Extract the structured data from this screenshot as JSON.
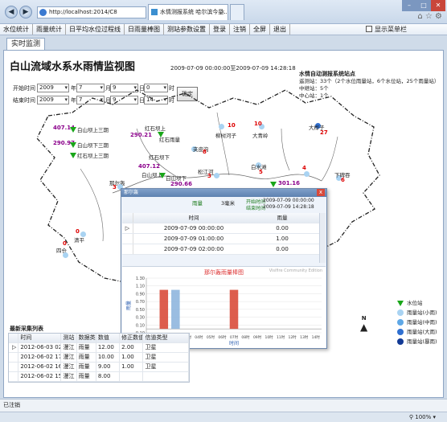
{
  "browser": {
    "address": "http://localhost:2014/C8",
    "tabs": [
      {
        "label": "水情测报系统 哈尔滨今星..."
      },
      {
        "label": ""
      }
    ],
    "window_buttons": [
      "–",
      "□",
      "✕"
    ]
  },
  "menu": {
    "items": [
      "水位统计",
      "雨量统计",
      "日平均水位过程线",
      "日雨量棒图",
      "测站参数设置",
      "登录",
      "注销",
      "全屏",
      "退出"
    ],
    "show_menu_label": "显示菜单栏"
  },
  "page_tab": "实时监测",
  "page": {
    "title": "白山流域水系水雨情监视图",
    "time_range": "2009-07-09 00:00:00至2009-07-09 14:28:18",
    "start_label": "开始时间",
    "end_label": "结束时间",
    "start": {
      "year": "2009",
      "month": "7",
      "day": "9",
      "hour": "0"
    },
    "end": {
      "year": "2009",
      "month": "7",
      "day": "9",
      "hour": "14"
    },
    "unit_year": "年",
    "unit_month": "月",
    "unit_day": "日",
    "unit_hour": "时",
    "query_button": "确定"
  },
  "station_info": {
    "heading": "水情自动测报系统站点",
    "line1": "遥测站：33个（2个水位雨量站，6个水位站，25个雨量站）",
    "line2": "中继站：5个",
    "line3": "中心站：1个"
  },
  "map": {
    "stations": [
      {
        "name": "白山坝上三期",
        "value": "407.14",
        "kind": "water"
      },
      {
        "name": "白山坝下三期",
        "value": "290.97",
        "kind": "water"
      },
      {
        "name": "红石坝上三期",
        "value": "",
        "kind": "water"
      },
      {
        "name": "红石坝上",
        "value": "290.21",
        "kind": "water"
      },
      {
        "name": "红石雨量",
        "value": "",
        "kind": "rain"
      },
      {
        "name": "红石坝下",
        "value": "",
        "kind": "water"
      },
      {
        "name": "白山坝上",
        "value": "407.12",
        "kind": "water"
      },
      {
        "name": "白山坝下",
        "value": "290.66",
        "kind": "water"
      },
      {
        "name": "那尔轰",
        "value": "3",
        "kind": "rain"
      },
      {
        "name": "柳树河子",
        "value": "10",
        "kind": "rain"
      },
      {
        "name": "大青岭",
        "value": "10",
        "kind": "rain"
      },
      {
        "name": "大桦子",
        "value": "27",
        "kind": "rain"
      },
      {
        "name": "夹皮沟",
        "value": "8",
        "kind": "rain"
      },
      {
        "name": "白水滩",
        "value": "5",
        "kind": "rain"
      },
      {
        "name": "松江河",
        "value": "3",
        "kind": "rain"
      },
      {
        "name": "下碑吞",
        "value": "6",
        "kind": "rain"
      },
      {
        "name": "",
        "value": "301.16",
        "kind": "water"
      },
      {
        "name": "四仓",
        "value": "0",
        "kind": "rain"
      },
      {
        "name": "清平",
        "value": "0",
        "kind": "rain"
      },
      {
        "name": "",
        "value": "4",
        "kind": "rain"
      }
    ],
    "legend": [
      {
        "label": "水位站",
        "color": "#19a619"
      },
      {
        "label": "雨量站(小雨)",
        "color": "#a9d3f2"
      },
      {
        "label": "雨量站(中雨)",
        "color": "#5fa8e6"
      },
      {
        "label": "雨量站(大雨)",
        "color": "#2f6fd0"
      },
      {
        "label": "雨量站(暴雨)",
        "color": "#123a95"
      }
    ],
    "north": "N"
  },
  "popup": {
    "title": "那尔轰",
    "station_type": "雨量",
    "total": "3毫米",
    "start_label": "开始时间",
    "start_value": "2009-07-09 00:00:00",
    "end_label": "结束时间",
    "end_value": "2009-07-09 14:28:18",
    "close": "x",
    "table": {
      "headers": [
        "时间",
        "雨量"
      ],
      "rows": [
        [
          "2009-07-09 00:00:00",
          "0.00"
        ],
        [
          "2009-07-09 01:00:00",
          "1.00"
        ],
        [
          "2009-07-09 02:00:00",
          "0.00"
        ]
      ]
    },
    "chart": {
      "title": "那尔轰雨量棒图",
      "watermark": "Visifire Community Edition",
      "ylabel": "雨量",
      "xlabel": "时间"
    }
  },
  "chart_data": {
    "type": "bar",
    "title": "那尔轰雨量棒图",
    "xlabel": "时间",
    "ylabel": "雨量",
    "categories": [
      "00时",
      "01时",
      "02时",
      "03时",
      "04时",
      "05时",
      "06时",
      "07时",
      "08时",
      "09时",
      "10时",
      "11时",
      "12时",
      "13时",
      "14时"
    ],
    "series": [
      {
        "name": "",
        "values": [
          0,
          1,
          1,
          0,
          0,
          0,
          0,
          1,
          0,
          0,
          0,
          0,
          0,
          0,
          0
        ]
      }
    ],
    "ylim": [
      -0.1,
      1.3
    ],
    "yticks": [
      "1.30",
      "1.10",
      "0.90",
      "0.70",
      "0.50",
      "0.30",
      "0.10",
      "-0.10"
    ],
    "colors": [
      "#e0892b",
      "#d94b3a",
      "#8fb6de"
    ]
  },
  "latest_data": {
    "title": "最新采集列表",
    "headers": [
      "时间",
      "测站",
      "数据类型",
      "数值",
      "修正数值",
      "信道类型"
    ],
    "rows": [
      [
        "2012-06-03 02:00:00",
        "漫江",
        "雨量",
        "12.00",
        "2.00",
        "卫星"
      ],
      [
        "2012-06-02 17:00:00",
        "漫江",
        "雨量",
        "10.00",
        "1.00",
        "卫星"
      ],
      [
        "2012-06-02 16:00:00",
        "漫江",
        "雨量",
        "9.00",
        "1.00",
        "卫星"
      ],
      [
        "2012-06-02 15:00:00",
        "漫江",
        "雨量",
        "8.00",
        "",
        ""
      ]
    ]
  },
  "status": {
    "text": "已注销",
    "zoom": "100%"
  }
}
